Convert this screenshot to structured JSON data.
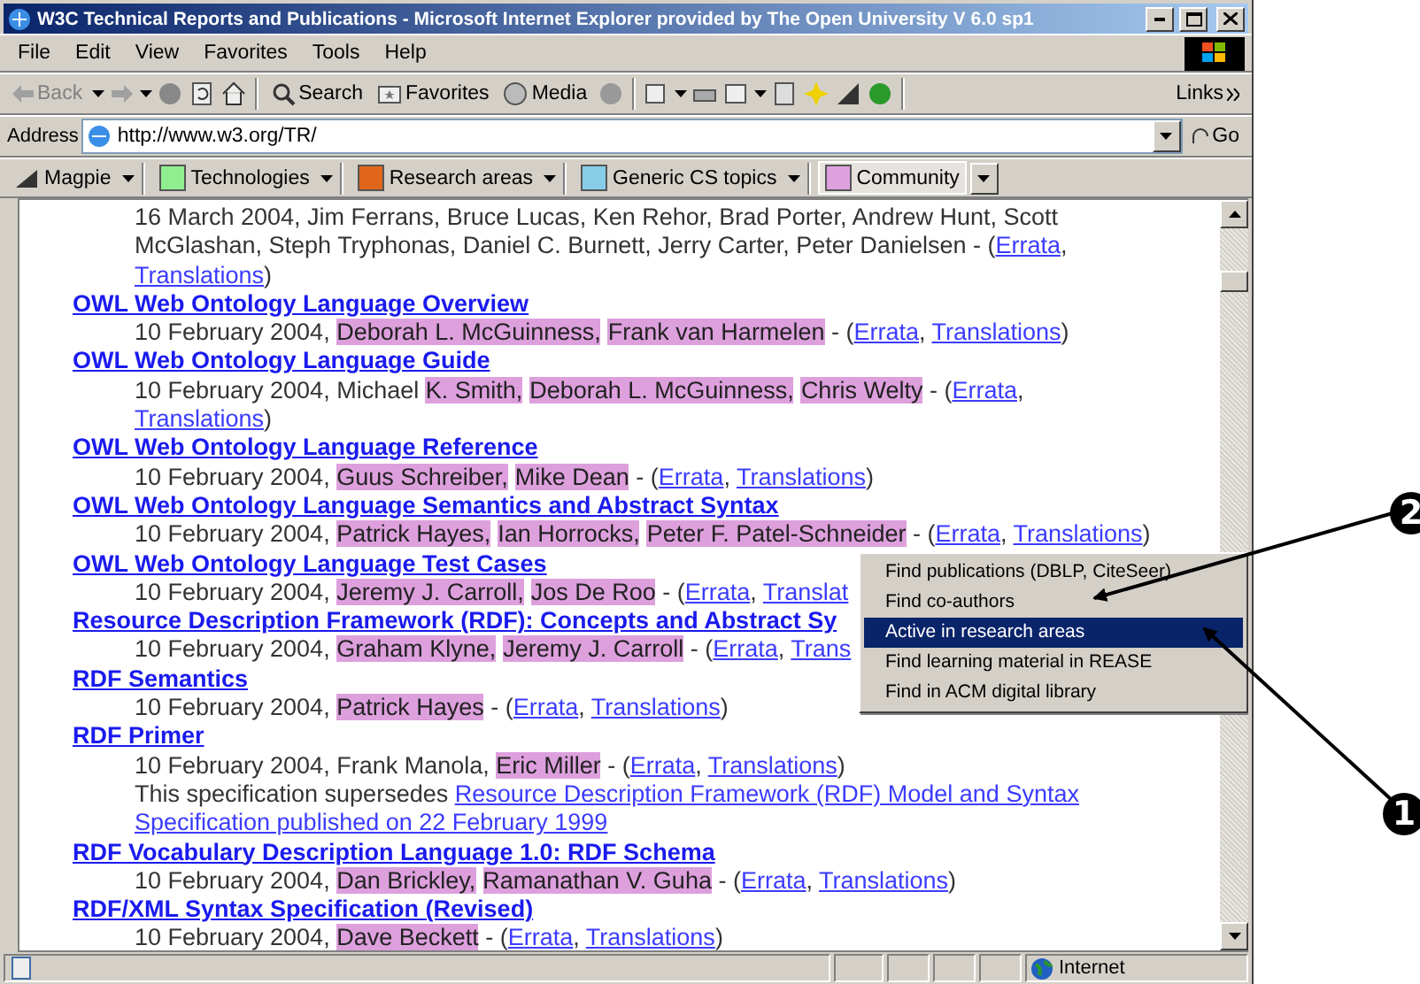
{
  "window": {
    "title": "W3C Technical Reports and Publications - Microsoft Internet Explorer provided by The Open University V 6.0 sp1"
  },
  "menu_bar": [
    "File",
    "Edit",
    "View",
    "Favorites",
    "Tools",
    "Help"
  ],
  "toolbar": {
    "back": "Back",
    "search": "Search",
    "favorites": "Favorites",
    "media": "Media",
    "links": "Links"
  },
  "address_bar": {
    "label": "Address",
    "value": "http://www.w3.org/TR/",
    "go": "Go"
  },
  "magpie_bar": [
    {
      "label": "Magpie",
      "kind": "logo",
      "selected": false
    },
    {
      "label": "Technologies",
      "kind": "category",
      "color": "#90ee90",
      "selected": false
    },
    {
      "label": "Research areas",
      "kind": "category",
      "color": "#e0661c",
      "selected": false
    },
    {
      "label": "Generic CS topics",
      "kind": "category",
      "color": "#87cde8",
      "selected": false
    },
    {
      "label": "Community",
      "kind": "category",
      "color": "#dda0dd",
      "selected": true
    }
  ],
  "entries": [
    {
      "lines": [
        [
          {
            "kind": "text",
            "text": "16 March 2004, Jim Ferrans, Bruce Lucas, Ken Rehor, Brad Porter, Andrew Hunt, Scott"
          }
        ],
        [
          {
            "kind": "text",
            "text": "McGlashan, Steph Tryphonas, Daniel C. Burnett, Jerry Carter, Peter Danielsen - ("
          },
          {
            "kind": "link",
            "text": "Errata"
          },
          {
            "kind": "text",
            "text": ","
          }
        ],
        [
          {
            "kind": "link",
            "text": "Translations"
          },
          {
            "kind": "text",
            "text": ")"
          }
        ]
      ]
    },
    {
      "title": "OWL Web Ontology Language Overview",
      "lines": [
        [
          {
            "kind": "text",
            "text": "10 February 2004, "
          },
          {
            "kind": "author",
            "text": "Deborah L. McGuinness,"
          },
          {
            "kind": "author",
            "text": "Frank van Harmelen"
          },
          {
            "kind": "text",
            "text": " - ("
          },
          {
            "kind": "link",
            "text": "Errata"
          },
          {
            "kind": "text",
            "text": ", "
          },
          {
            "kind": "link",
            "text": "Translations"
          },
          {
            "kind": "text",
            "text": ")"
          }
        ]
      ]
    },
    {
      "title": "OWL Web Ontology Language Guide",
      "lines": [
        [
          {
            "kind": "text",
            "text": "10 February 2004, Michael "
          },
          {
            "kind": "author",
            "text": "K. Smith,"
          },
          {
            "kind": "author",
            "text": "Deborah L. McGuinness,"
          },
          {
            "kind": "author",
            "text": "Chris Welty"
          },
          {
            "kind": "text",
            "text": " - ("
          },
          {
            "kind": "link",
            "text": "Errata"
          },
          {
            "kind": "text",
            "text": ","
          }
        ],
        [
          {
            "kind": "link",
            "text": "Translations"
          },
          {
            "kind": "text",
            "text": ")"
          }
        ]
      ]
    },
    {
      "title": "OWL Web Ontology Language Reference",
      "lines": [
        [
          {
            "kind": "text",
            "text": "10 February 2004, "
          },
          {
            "kind": "author",
            "text": "Guus Schreiber,"
          },
          {
            "kind": "author",
            "text": "Mike Dean"
          },
          {
            "kind": "text",
            "text": " - ("
          },
          {
            "kind": "link",
            "text": "Errata"
          },
          {
            "kind": "text",
            "text": ", "
          },
          {
            "kind": "link",
            "text": "Translations"
          },
          {
            "kind": "text",
            "text": ")"
          }
        ]
      ]
    },
    {
      "title": "OWL Web Ontology Language Semantics and Abstract Syntax",
      "lines": [
        [
          {
            "kind": "text",
            "text": "10 February 2004, "
          },
          {
            "kind": "author",
            "text": "Patrick Hayes,"
          },
          {
            "kind": "author",
            "text": "Ian Horrocks,"
          },
          {
            "kind": "author",
            "text": "Peter F. Patel-Schneider"
          },
          {
            "kind": "text",
            "text": " - ("
          },
          {
            "kind": "link",
            "text": "Errata"
          },
          {
            "kind": "text",
            "text": ", "
          },
          {
            "kind": "link",
            "text": "Translations"
          },
          {
            "kind": "text",
            "text": ")"
          }
        ]
      ]
    },
    {
      "title": "OWL Web Ontology Language Test Cases",
      "lines": [
        [
          {
            "kind": "text",
            "text": "10 February 2004, "
          },
          {
            "kind": "author",
            "text": "Jeremy J. Carroll,"
          },
          {
            "kind": "author",
            "text": "Jos De Roo"
          },
          {
            "kind": "text",
            "text": " - ("
          },
          {
            "kind": "link",
            "text": "Errata"
          },
          {
            "kind": "text",
            "text": ", "
          },
          {
            "kind": "link",
            "text": "Translat"
          }
        ]
      ]
    },
    {
      "title": "Resource Description Framework (RDF): Concepts and Abstract Sy",
      "lines": [
        [
          {
            "kind": "text",
            "text": "10 February 2004, "
          },
          {
            "kind": "author",
            "text": "Graham Klyne,"
          },
          {
            "kind": "author",
            "text": "Jeremy J. Carroll"
          },
          {
            "kind": "text",
            "text": " - ("
          },
          {
            "kind": "link",
            "text": "Errata"
          },
          {
            "kind": "text",
            "text": ", "
          },
          {
            "kind": "link",
            "text": "Trans"
          }
        ]
      ]
    },
    {
      "title": "RDF Semantics",
      "lines": [
        [
          {
            "kind": "text",
            "text": "10 February 2004, "
          },
          {
            "kind": "author",
            "text": "Patrick Hayes"
          },
          {
            "kind": "text",
            "text": " - ("
          },
          {
            "kind": "link",
            "text": "Errata"
          },
          {
            "kind": "text",
            "text": ", "
          },
          {
            "kind": "link",
            "text": "Translations"
          },
          {
            "kind": "text",
            "text": ")"
          }
        ]
      ]
    },
    {
      "title": "RDF Primer",
      "lines": [
        [
          {
            "kind": "text",
            "text": "10 February 2004, Frank Manola, "
          },
          {
            "kind": "author",
            "text": "Eric Miller"
          },
          {
            "kind": "text",
            "text": " - ("
          },
          {
            "kind": "link",
            "text": "Errata"
          },
          {
            "kind": "text",
            "text": ", "
          },
          {
            "kind": "link",
            "text": "Translations"
          },
          {
            "kind": "text",
            "text": ")"
          }
        ],
        [
          {
            "kind": "text",
            "text": "This specification supersedes "
          },
          {
            "kind": "link",
            "text": "Resource Description Framework (RDF) Model and Syntax"
          }
        ],
        [
          {
            "kind": "link",
            "text": "Specification published on 22 February 1999"
          }
        ]
      ]
    },
    {
      "title": "RDF Vocabulary Description Language 1.0: RDF Schema",
      "lines": [
        [
          {
            "kind": "text",
            "text": "10 February 2004, "
          },
          {
            "kind": "author",
            "text": "Dan Brickley,"
          },
          {
            "kind": "author",
            "text": "Ramanathan V. Guha"
          },
          {
            "kind": "text",
            "text": " - ("
          },
          {
            "kind": "link",
            "text": "Errata"
          },
          {
            "kind": "text",
            "text": ", "
          },
          {
            "kind": "link",
            "text": "Translations"
          },
          {
            "kind": "text",
            "text": ")"
          }
        ]
      ]
    },
    {
      "title": "RDF/XML Syntax Specification (Revised)",
      "lines": [
        [
          {
            "kind": "text",
            "text": "10 February 2004, "
          },
          {
            "kind": "author",
            "text": "Dave Beckett"
          },
          {
            "kind": "text",
            "text": " - ("
          },
          {
            "kind": "link",
            "text": "Errata"
          },
          {
            "kind": "text",
            "text": ", "
          },
          {
            "kind": "link",
            "text": "Translations"
          },
          {
            "kind": "text",
            "text": ")"
          }
        ]
      ]
    }
  ],
  "context_menu": [
    {
      "label": "Find publications (DBLP, CiteSeer)",
      "selected": false
    },
    {
      "label": "Find co-authors",
      "selected": false
    },
    {
      "label": "Active in research areas",
      "selected": true
    },
    {
      "label": "Find learning material in REASE",
      "selected": false
    },
    {
      "label": "Find in ACM digital library",
      "selected": false
    }
  ],
  "callouts": [
    {
      "number": "2"
    },
    {
      "number": "1"
    }
  ],
  "status_bar": {
    "zone": "Internet"
  }
}
